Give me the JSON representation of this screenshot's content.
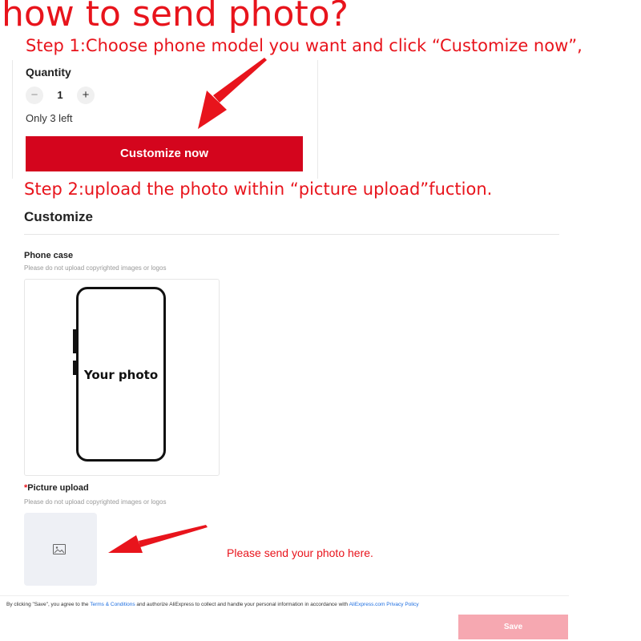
{
  "heading": "how to send photo?",
  "steps": {
    "step1": "Step 1:Choose phone model you want and click “Customize now”,",
    "step2": "Step 2:upload the photo within “picture upload”fuction."
  },
  "product": {
    "quantity_label": "Quantity",
    "minus_symbol": "−",
    "plus_symbol": "+",
    "quantity_value": "1",
    "stock_text": "Only 3 left",
    "customize_button": "Customize now"
  },
  "customize": {
    "title": "Customize",
    "phone_case_label": "Phone case",
    "phone_case_hint": "Please do not upload copyrighted images or logos",
    "preview_text": "Your photo",
    "picture_upload_required": "*",
    "picture_upload_label": "Picture upload",
    "picture_upload_hint": "Please do not upload copyrighted images or logos",
    "upload_icon": "image-icon",
    "send_note": "Please send your photo here."
  },
  "footer": {
    "consent_prefix": "By clicking \"Save\", you agree to the ",
    "terms_link": "Terms & Conditions",
    "consent_middle": " and authorize AliExpress to collect and handle your personal information in accordance with ",
    "privacy_link": "AliExpress.com Privacy Policy",
    "save_button": "Save"
  },
  "colors": {
    "accent_red": "#e8141c",
    "button_red": "#d4051d",
    "save_disabled": "#f6a8b1",
    "link_blue": "#1f6fe0"
  }
}
